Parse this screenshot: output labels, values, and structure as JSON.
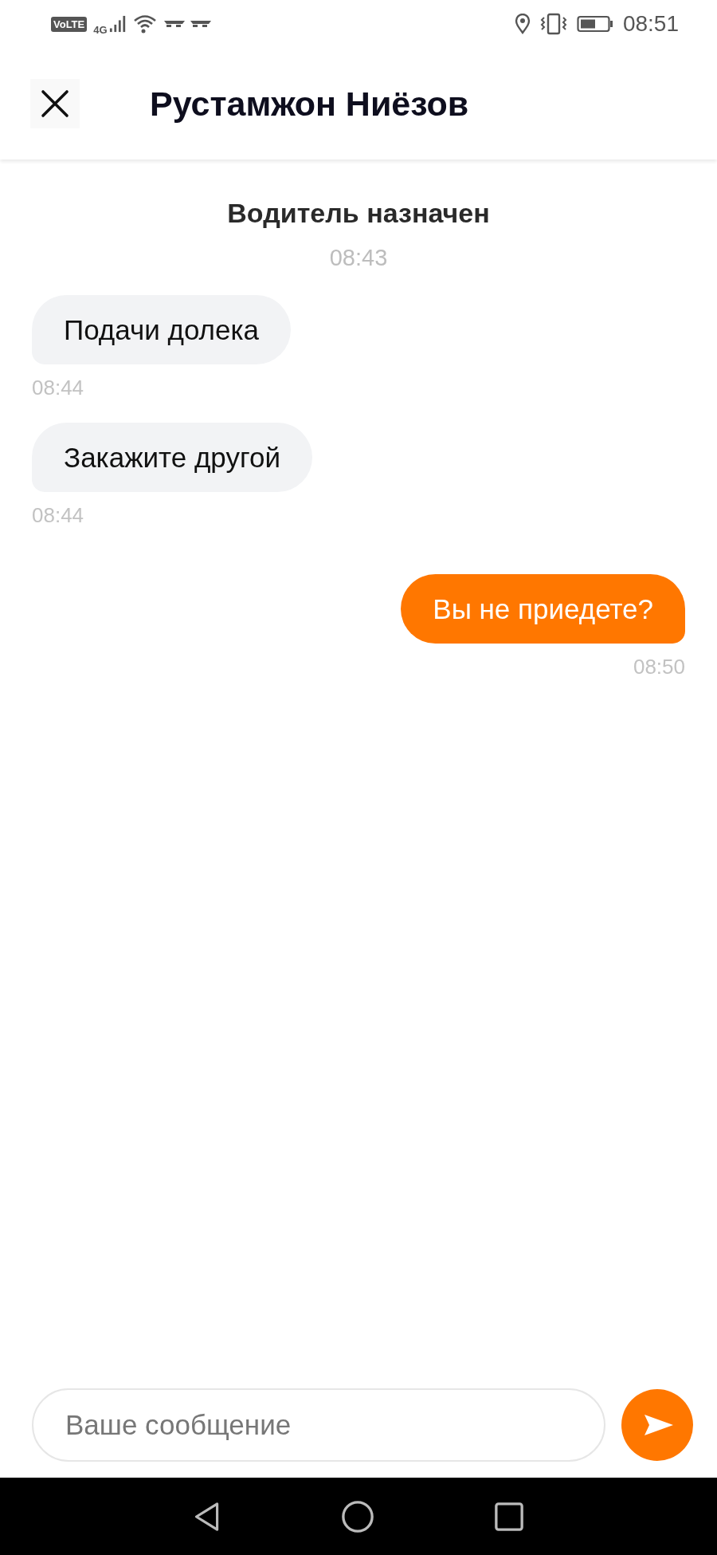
{
  "status_bar": {
    "volte": "VoLTE",
    "network": "4G",
    "time": "08:51"
  },
  "header": {
    "title": "Рустамжон Ниёзов"
  },
  "messages": [
    {
      "kind": "system",
      "text": "Водитель назначен",
      "time": "08:43"
    },
    {
      "kind": "incoming",
      "text": "Подачи долека",
      "time": "08:44"
    },
    {
      "kind": "incoming",
      "text": "Закажите другой",
      "time": "08:44"
    },
    {
      "kind": "outgoing",
      "text": "Вы не приедете?",
      "time": "08:50"
    }
  ],
  "composer": {
    "placeholder": "Ваше сообщение"
  }
}
